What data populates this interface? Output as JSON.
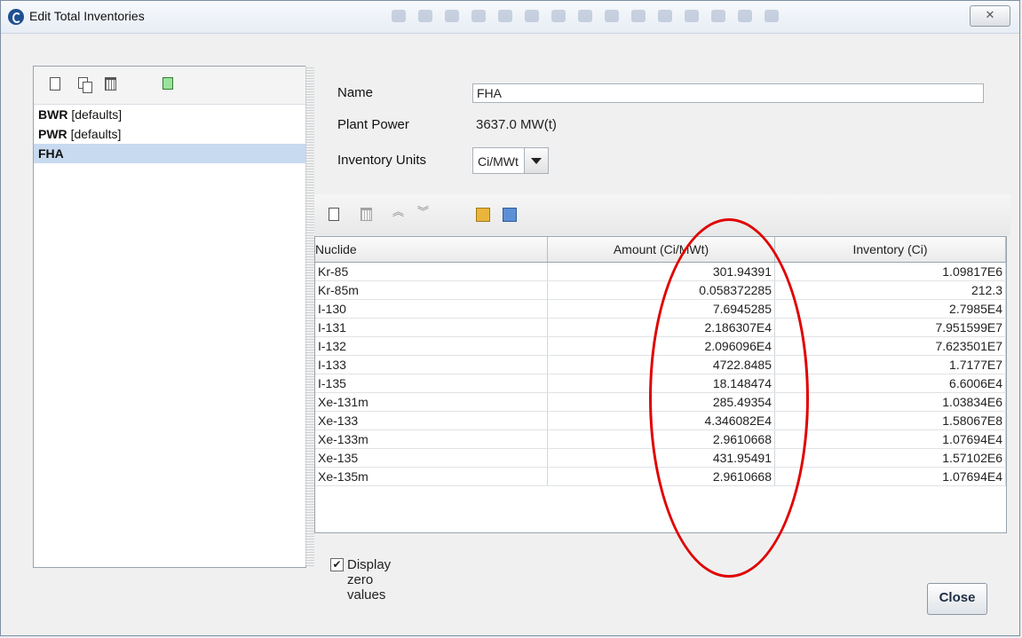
{
  "window": {
    "title": "Edit Total Inventories"
  },
  "left_list": {
    "items": [
      {
        "name": "BWR",
        "tag": "[defaults]"
      },
      {
        "name": "PWR",
        "tag": "[defaults]"
      },
      {
        "name": "FHA",
        "tag": ""
      }
    ]
  },
  "form": {
    "name_label": "Name",
    "name_value": "FHA",
    "plant_power_label": "Plant Power",
    "plant_power_value": "3637.0 MW(t)",
    "inventory_units_label": "Inventory Units",
    "inventory_units_value": "Ci/MWt"
  },
  "table": {
    "headers": [
      "Nuclide",
      "Amount (Ci/MWt)",
      "Inventory (Ci)"
    ],
    "rows": [
      [
        "Kr-85",
        "301.94391",
        "1.09817E6"
      ],
      [
        "Kr-85m",
        "0.058372285",
        "212.3"
      ],
      [
        "I-130",
        "7.6945285",
        "2.7985E4"
      ],
      [
        "I-131",
        "2.186307E4",
        "7.951599E7"
      ],
      [
        "I-132",
        "2.096096E4",
        "7.623501E7"
      ],
      [
        "I-133",
        "4722.8485",
        "1.7177E7"
      ],
      [
        "I-135",
        "18.148474",
        "6.6006E4"
      ],
      [
        "Xe-131m",
        "285.49354",
        "1.03834E6"
      ],
      [
        "Xe-133",
        "4.346082E4",
        "1.58067E8"
      ],
      [
        "Xe-133m",
        "2.9610668",
        "1.07694E4"
      ],
      [
        "Xe-135",
        "431.95491",
        "1.57102E6"
      ],
      [
        "Xe-135m",
        "2.9610668",
        "1.07694E4"
      ]
    ]
  },
  "display_zero": {
    "label": "Display zero values",
    "checked": true,
    "mark": "✔"
  },
  "buttons": {
    "close_label": "Close",
    "window_close_glyph": "✕"
  },
  "colors": {
    "selection": "#c8daf0",
    "annotation": "#e00000"
  }
}
